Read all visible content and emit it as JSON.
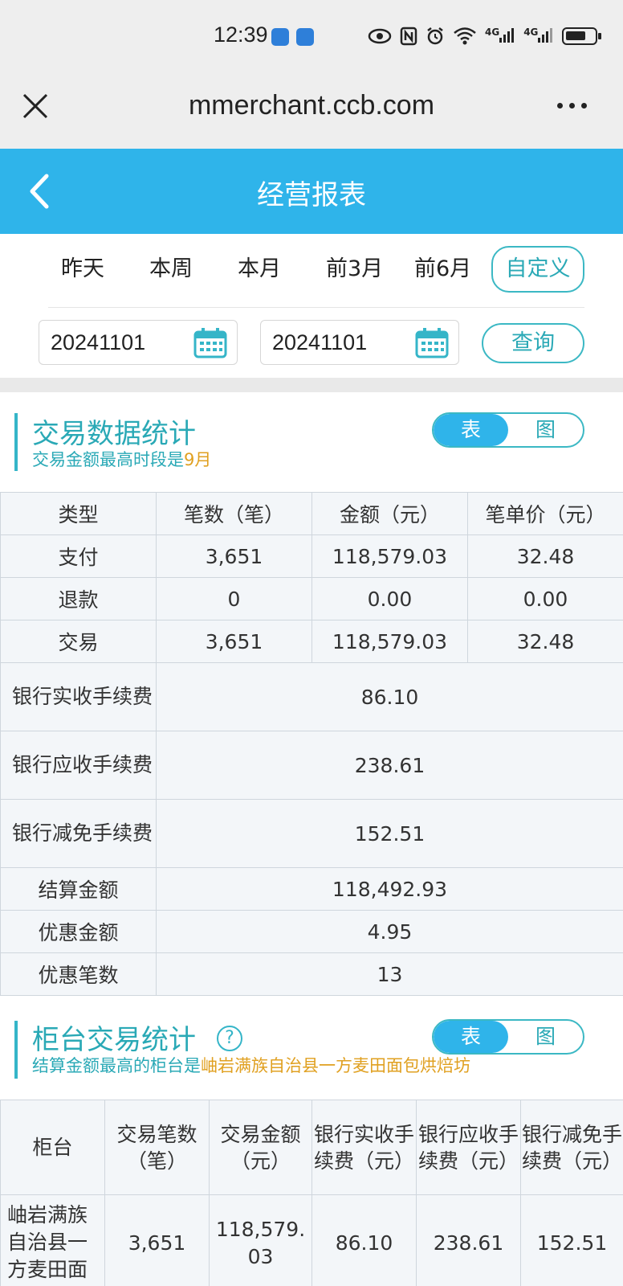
{
  "status": {
    "time": "12:39",
    "net1": "4G",
    "net2": "4G"
  },
  "browser": {
    "url": "mmerchant.ccb.com"
  },
  "header": {
    "title": "经营报表"
  },
  "periods": [
    "昨天",
    "本周",
    "本月",
    "前3月",
    "前6月"
  ],
  "custom_label": "自定义",
  "date_range": {
    "start": "20241101",
    "end": "20241101"
  },
  "query_label": "查询",
  "section1": {
    "title": "交易数据统计",
    "subtitle_prefix": "交易金额最高时段是",
    "subtitle_highlight": "9月",
    "toggle": {
      "table": "表",
      "chart": "图"
    },
    "columns": [
      "类型",
      "笔数（笔）",
      "金额（元）",
      "笔单价（元）"
    ],
    "rows": [
      [
        "支付",
        "3,651",
        "118,579.03",
        "32.48"
      ],
      [
        "退款",
        "0",
        "0.00",
        "0.00"
      ],
      [
        "交易",
        "3,651",
        "118,579.03",
        "32.48"
      ]
    ],
    "fees": [
      {
        "label": "银行实收手续费",
        "value": "86.10"
      },
      {
        "label": "银行应收手续费",
        "value": "238.61"
      },
      {
        "label": "银行减免手续费",
        "value": "152.51"
      }
    ],
    "summary": [
      {
        "label": "结算金额",
        "value": "118,492.93"
      },
      {
        "label": "优惠金额",
        "value": "4.95"
      },
      {
        "label": "优惠笔数",
        "value": "13"
      }
    ]
  },
  "section2": {
    "title": "柜台交易统计",
    "help": "?",
    "subtitle_prefix": "结算金额最高的柜台是",
    "subtitle_highlight": "岫岩满族自治县一方麦田面包烘焙坊",
    "toggle": {
      "table": "表",
      "chart": "图"
    },
    "columns": [
      "柜台",
      "交易笔数（笔）",
      "交易金额（元）",
      "银行实收手续费（元）",
      "银行应收手续费（元）",
      "银行减免手续费（元）"
    ],
    "row": {
      "counter": "岫岩满族自治县一方麦田面包烘焙坊",
      "count": "3,651",
      "amount": "118,579.03",
      "fee_actual": "86.10",
      "fee_due": "238.61",
      "fee_waived": "152.51"
    }
  },
  "colors": {
    "accent": "#2fb4ea",
    "teal": "#35b5c8",
    "highlight": "#e0a020"
  }
}
